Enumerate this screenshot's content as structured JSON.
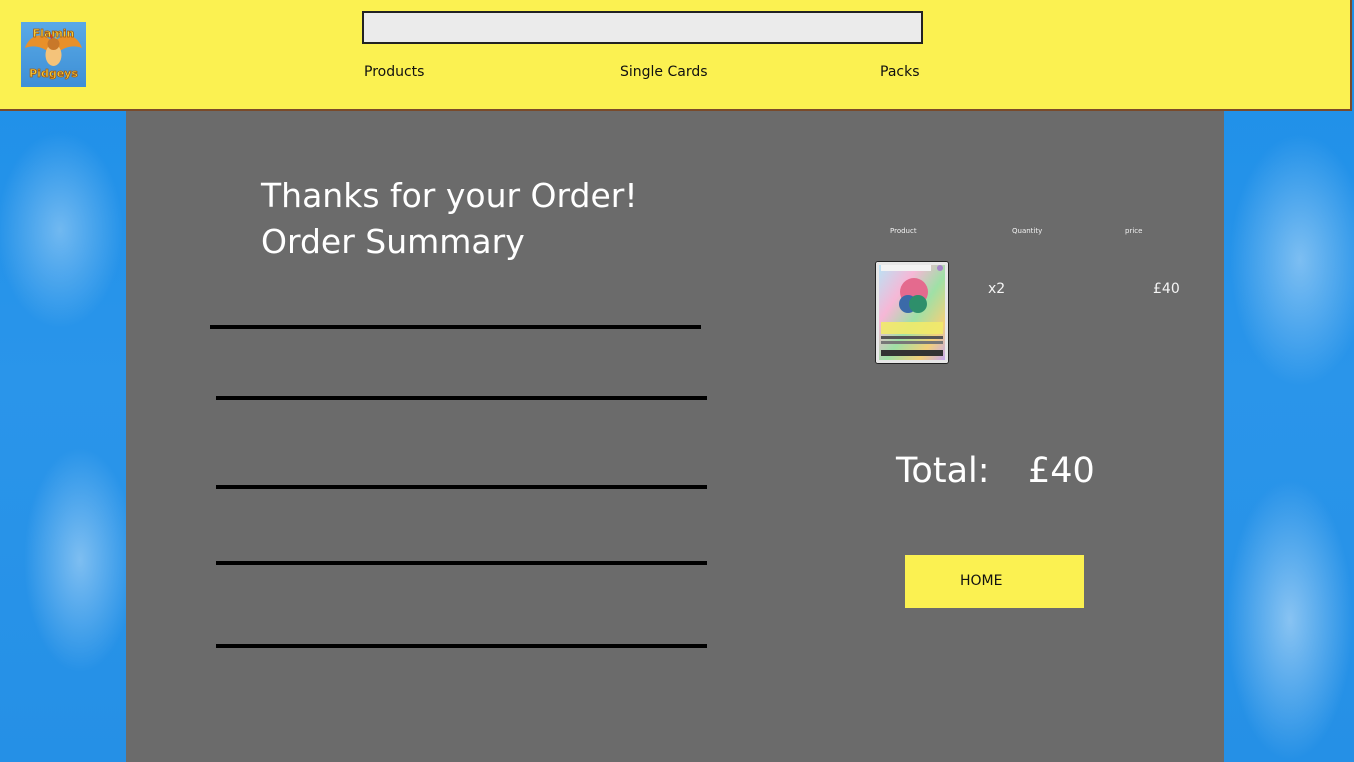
{
  "header": {
    "logo_text": [
      "Flamin",
      "Pidgeys"
    ],
    "search": {
      "value": "",
      "placeholder": ""
    },
    "nav": [
      {
        "label": "Products"
      },
      {
        "label": "Single Cards"
      },
      {
        "label": "Packs"
      }
    ]
  },
  "order": {
    "heading_line1": "Thanks for your Order!",
    "heading_line2": "Order Summary",
    "table": {
      "columns": [
        "Product",
        "Quantity",
        "price"
      ],
      "rows": [
        {
          "quantity": "x2",
          "price": "£40"
        }
      ]
    },
    "total_label": "Total:",
    "total_value": "£40",
    "home_label": "HOME"
  },
  "colors": {
    "header_bg": "#fbf151",
    "panel_bg": "#6b6b6b",
    "page_bg": "#1d8fe8",
    "button_bg": "#fbf151"
  }
}
